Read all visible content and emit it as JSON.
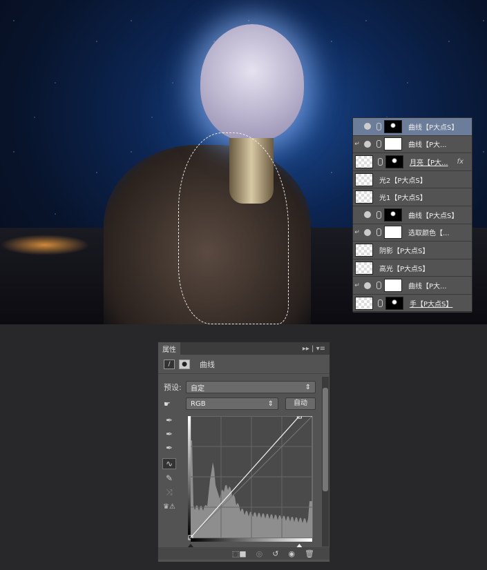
{
  "layers": [
    {
      "name": "曲线【P大点S】",
      "clip": false,
      "eye": true,
      "thumb": "blk",
      "selected": true
    },
    {
      "name": "曲线【P大...",
      "clip": true,
      "eye": true,
      "thumb": "wht"
    },
    {
      "name": "月亮【P大...",
      "clip": false,
      "eye": false,
      "thumb": "blk",
      "smart": true,
      "fx": "fx"
    },
    {
      "name": "光2【P大点S】",
      "clip": false,
      "eye": false,
      "thumb": "chk",
      "nomask": true
    },
    {
      "name": "光1【P大点S】",
      "clip": false,
      "eye": false,
      "thumb": "chk",
      "nomask": true
    },
    {
      "name": "曲线【P大点S】",
      "clip": false,
      "eye": true,
      "thumb": "blk"
    },
    {
      "name": "选取颜色【...",
      "clip": true,
      "eye": true,
      "thumb": "wht"
    },
    {
      "name": "阴影【P大点S】",
      "clip": true,
      "eye": false,
      "thumb": "chk",
      "nomask": true
    },
    {
      "name": "高光【P大点S】",
      "clip": true,
      "eye": false,
      "thumb": "chk",
      "nomask": true
    },
    {
      "name": "曲线【P大...",
      "clip": true,
      "eye": true,
      "thumb": "wht"
    },
    {
      "name": "手【P大点S】",
      "clip": false,
      "eye": false,
      "thumb": "blk",
      "smart": true
    }
  ],
  "properties": {
    "tab": "属性",
    "title": "曲线",
    "preset_label": "预设:",
    "preset_value": "自定",
    "channel": "RGB",
    "auto_button": "自动",
    "curve_points": [
      [
        0,
        0
      ],
      [
        228,
        255
      ]
    ],
    "accent": "#6b7d99"
  }
}
